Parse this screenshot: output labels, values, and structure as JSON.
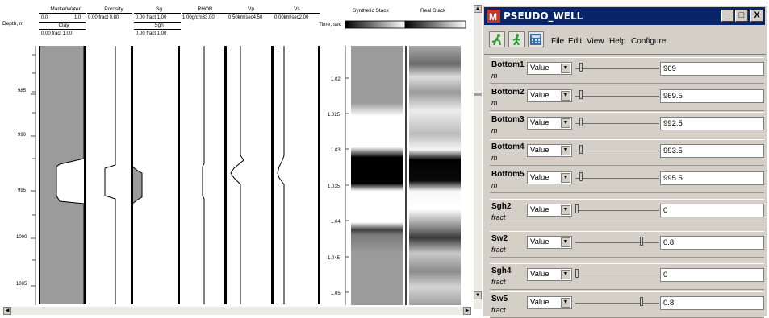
{
  "log_plot": {
    "depth_label": "Depth, m",
    "depth_ticks": [
      "985",
      "990",
      "995",
      "1000",
      "1005"
    ],
    "tracks": [
      {
        "title": "MarkerWater",
        "range1": [
          "0.0",
          "1.0"
        ],
        "sub_title": "Clay",
        "range2": "0.00 fract 1.00"
      },
      {
        "title": "Porosity",
        "range1": "0.00 fract 0.80"
      },
      {
        "title": "Sg",
        "range1": "0.00 fract 1.00",
        "sub_title": "Sgh",
        "range2": "0.00 fract 1.00"
      },
      {
        "title": "RHOB",
        "range1": "1.00g/cm33.00"
      },
      {
        "title": "Vp",
        "range1": "0.50km/sec4.50"
      },
      {
        "title": "Vs",
        "range1": "0.00km/sec2.00"
      }
    ]
  },
  "seismic": {
    "time_label": "Time, sec",
    "synthetic_title": "Synthetic Stack",
    "real_title": "Real Stack",
    "time_ticks": [
      "1.02",
      "1.025",
      "1.03",
      "1.035",
      "1.04",
      "1.045",
      "1.05"
    ]
  },
  "dialog": {
    "title": "PSEUDO_WELL",
    "window_buttons": {
      "minimize": "_",
      "maximize": "□",
      "close": "X"
    },
    "toolbar_icons": [
      "run-icon",
      "walk-icon",
      "calculator-icon"
    ],
    "menu": [
      "File",
      "Edit",
      "View",
      "Help",
      "Configure"
    ],
    "params": [
      {
        "name": "Bottom1",
        "unit": "m",
        "mode": "Value",
        "value": "969",
        "slider": 0.05
      },
      {
        "name": "Bottom2",
        "unit": "m",
        "mode": "Value",
        "value": "969.5",
        "slider": 0.05
      },
      {
        "name": "Bottom3",
        "unit": "m",
        "mode": "Value",
        "value": "992.5",
        "slider": 0.05
      },
      {
        "name": "Bottom4",
        "unit": "m",
        "mode": "Value",
        "value": "993.5",
        "slider": 0.05
      },
      {
        "name": "Bottom5",
        "unit": "m",
        "mode": "Value",
        "value": "995.5",
        "slider": 0.05
      },
      {
        "name": "Sgh2",
        "unit": "fract",
        "mode": "Value",
        "value": "0",
        "slider": 0.0
      },
      {
        "name": "Sw2",
        "unit": "fract",
        "mode": "Value",
        "value": "0.8",
        "slider": 0.8
      },
      {
        "name": "Sgh4",
        "unit": "fract",
        "mode": "Value",
        "value": "0",
        "slider": 0.0
      },
      {
        "name": "Sw5",
        "unit": "fract",
        "mode": "Value",
        "value": "0.8",
        "slider": 0.8
      }
    ]
  },
  "colors": {
    "titlebar": "#0a246a",
    "dialog_bg": "#d4d0c8",
    "log_fill": "#9b9b9b"
  }
}
